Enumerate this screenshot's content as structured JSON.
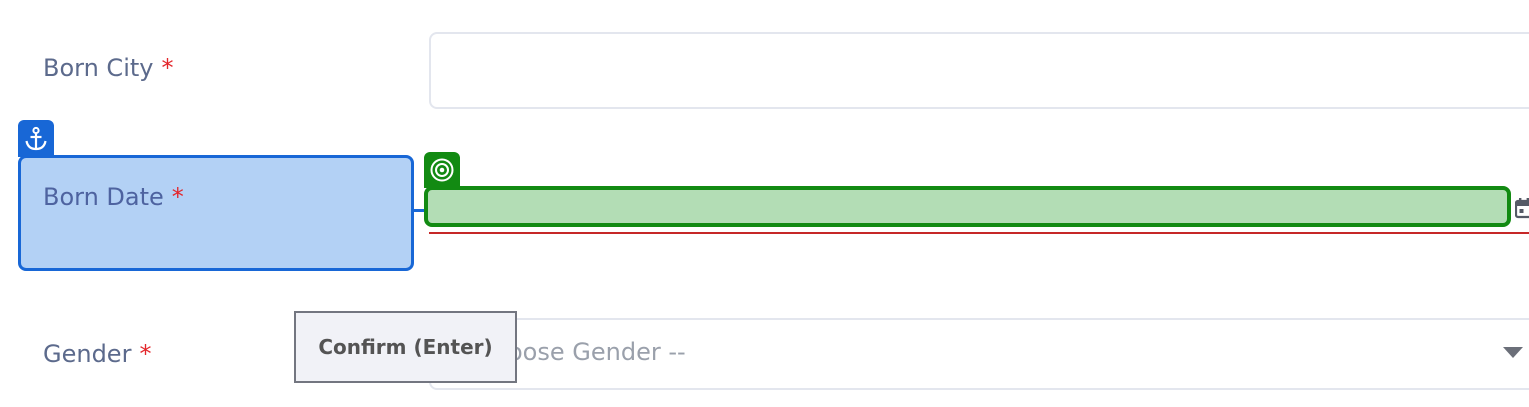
{
  "form": {
    "born_city": {
      "label": "Born City",
      "required_mark": "*",
      "value": ""
    },
    "born_date": {
      "label": "Born Date",
      "required_mark": "*",
      "value": ""
    },
    "gender": {
      "label": "Gender",
      "required_mark": "*",
      "placeholder": "-- Choose Gender --",
      "visible_placeholder": "oose Gender --"
    }
  },
  "overlay": {
    "anchor_icon": "anchor-icon",
    "target_icon": "target-icon",
    "anchor_color": "#1867d6",
    "anchor_fill": "#b3d1f5",
    "target_color": "#128a12",
    "target_fill": "#b3ddb5",
    "confirm_label": "Confirm (Enter)"
  },
  "colors": {
    "label_text": "#5c6a8c",
    "required": "#e3262b",
    "error_underline": "#c62828"
  }
}
